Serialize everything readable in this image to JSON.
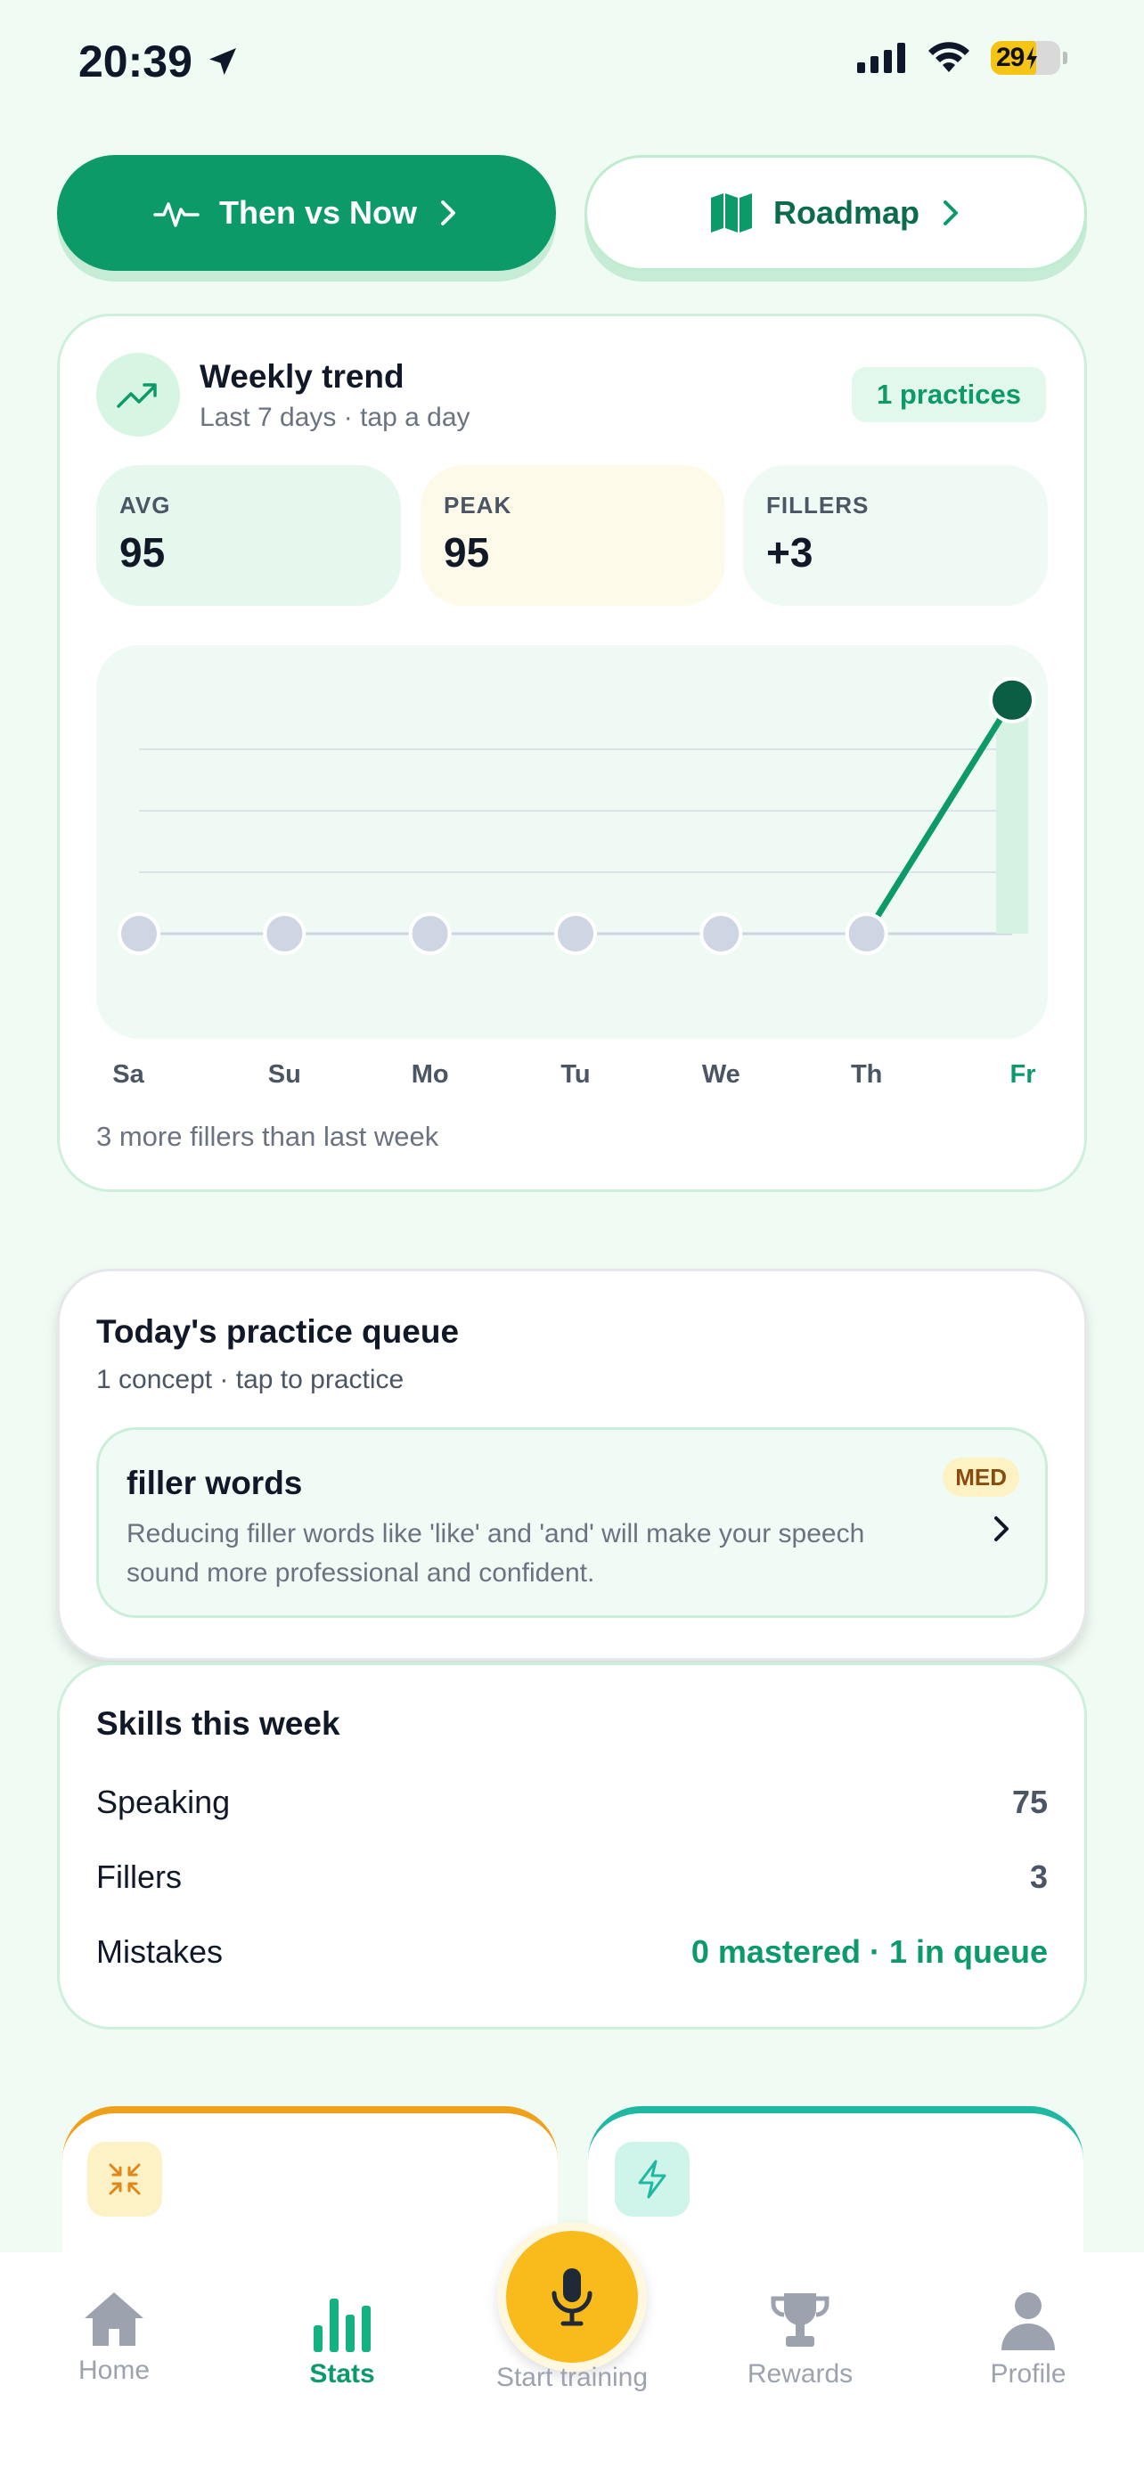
{
  "status_bar": {
    "time": "20:39",
    "battery": "29"
  },
  "top_buttons": {
    "then_vs_now": "Then vs Now",
    "roadmap": "Roadmap"
  },
  "weekly": {
    "title": "Weekly trend",
    "subtitle": "Last 7 days · tap a day",
    "practices": "1 practices",
    "stats": [
      {
        "label": "AVG",
        "value": "95"
      },
      {
        "label": "PEAK",
        "value": "95"
      },
      {
        "label": "FILLERS",
        "value": "+3"
      }
    ],
    "footer": "3 more fillers than last week"
  },
  "chart_data": {
    "type": "line",
    "categories": [
      "Sa",
      "Su",
      "Mo",
      "Tu",
      "We",
      "Th",
      "Fr"
    ],
    "values": [
      0,
      0,
      0,
      0,
      0,
      0,
      95
    ],
    "active_index": 6,
    "ylim": [
      0,
      100
    ],
    "grid": true,
    "colors": {
      "line": "#0b9a68",
      "point": "#cfd6e3",
      "active_point": "#0b5e43"
    }
  },
  "queue": {
    "title": "Today's practice queue",
    "subtitle": "1 concept · tap to practice",
    "concept": {
      "name": "filler words",
      "badge": "MED",
      "description": "Reducing filler words like 'like' and 'and' will make your speech sound more professional and confident."
    }
  },
  "skills": {
    "title": "Skills this week",
    "rows": [
      {
        "name": "Speaking",
        "value": "75"
      },
      {
        "name": "Fillers",
        "value": "3"
      },
      {
        "name": "Mistakes",
        "value": "0 mastered · 1 in queue"
      }
    ]
  },
  "nav": {
    "items": [
      {
        "label": "Home",
        "icon": "home-icon"
      },
      {
        "label": "Stats",
        "icon": "bar-chart-icon"
      },
      {
        "label": "Start training",
        "icon": "microphone-icon"
      },
      {
        "label": "Rewards",
        "icon": "trophy-icon"
      },
      {
        "label": "Profile",
        "icon": "person-icon"
      }
    ],
    "active": "Stats"
  },
  "colors": {
    "accent": "#0b9a68",
    "background": "#effbf3",
    "mic": "#f9bb1c"
  }
}
